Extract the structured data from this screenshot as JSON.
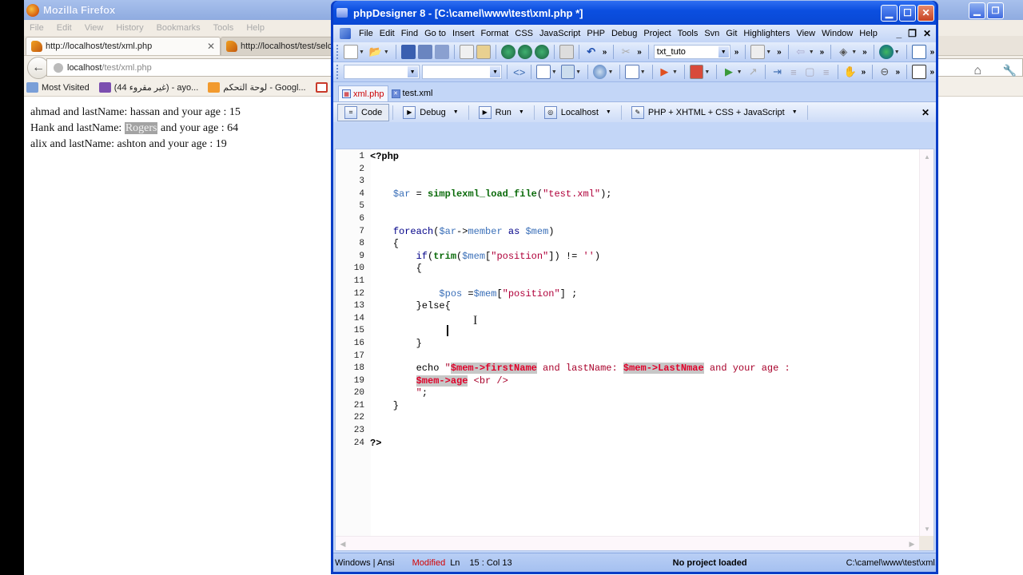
{
  "firefox": {
    "window_title": "Mozilla Firefox",
    "menu": [
      "File",
      "Edit",
      "View",
      "History",
      "Bookmarks",
      "Tools",
      "Help"
    ],
    "tabs": [
      {
        "label": "http://localhost/test/xml.php",
        "active": true
      },
      {
        "label": "http://localhost/test/selc",
        "active": false
      }
    ],
    "url": {
      "host": "localhost",
      "path": "/test/xml.php"
    },
    "bookmarks": [
      {
        "label": "Most Visited",
        "icon": "most-visited-icon"
      },
      {
        "label": "(غير مقروء 44) - ayo...",
        "icon": "mail-icon"
      },
      {
        "label": "لوحة التحكم - Googl...",
        "icon": "analytics-icon"
      },
      {
        "label": "",
        "icon": "gmail-icon"
      }
    ],
    "page_lines": [
      {
        "first": "ahmad",
        "mid": " and lastName: ",
        "last": "hassan",
        "tail": " and your age : 15",
        "selected": false
      },
      {
        "first": "Hank",
        "mid": " and lastName: ",
        "last": "Rogers",
        "tail": " and your age : 64",
        "selected": true
      },
      {
        "first": "alix",
        "mid": " and lastName: ",
        "last": "ashton",
        "tail": " and your age : 19",
        "selected": false
      }
    ]
  },
  "phpdesigner": {
    "window_title": "phpDesigner 8 - [C:\\camel\\www\\test\\xml.php *]",
    "menu": [
      "File",
      "Edit",
      "Find",
      "Go to",
      "Insert",
      "Format",
      "CSS",
      "JavaScript",
      "PHP",
      "Debug",
      "Project",
      "Tools",
      "Svn",
      "Git",
      "Highlighters",
      "View",
      "Window",
      "Help"
    ],
    "toolbar_combo_value": "txt_tuto",
    "doc_tabs": [
      {
        "label": "xml.php",
        "active": true
      },
      {
        "label": "test.xml",
        "active": false
      }
    ],
    "run_bar": {
      "code": "Code",
      "debug": "Debug",
      "run": "Run",
      "server": "Localhost",
      "highlighter": "PHP + XHTML + CSS + JavaScript"
    },
    "code_lines": [
      {
        "n": "1",
        "html": "<span class=\"php-tag\">&lt;?php</span>"
      },
      {
        "n": "2",
        "html": ""
      },
      {
        "n": "3",
        "html": ""
      },
      {
        "n": "4",
        "html": "    <span class=\"var\">$ar</span> = <span class=\"fn\">simplexml_load_file</span>(<span class=\"str\">\"test.xml\"</span>);"
      },
      {
        "n": "5",
        "html": ""
      },
      {
        "n": "6",
        "html": ""
      },
      {
        "n": "7",
        "html": "    <span class=\"kw\">foreach</span>(<span class=\"var\">$ar</span>-&gt;<span class=\"prop\">member</span> <span class=\"kw\">as</span> <span class=\"var\">$mem</span>)"
      },
      {
        "n": "8",
        "html": "    {"
      },
      {
        "n": "9",
        "html": "        <span class=\"kw\">if</span>(<span class=\"fn\">trim</span>(<span class=\"var\">$mem</span>[<span class=\"str\">\"position\"</span>]) != <span class=\"str\">''</span>)"
      },
      {
        "n": "10",
        "html": "        {"
      },
      {
        "n": "11",
        "html": ""
      },
      {
        "n": "12",
        "html": "            <span class=\"var\">$pos</span> =<span class=\"var\">$mem</span>[<span class=\"str\">\"position\"</span>] ;"
      },
      {
        "n": "13",
        "html": "        }else{"
      },
      {
        "n": "14",
        "html": ""
      },
      {
        "n": "15",
        "html": ""
      },
      {
        "n": "16",
        "html": "        }"
      },
      {
        "n": "17",
        "html": ""
      },
      {
        "n": "18",
        "html": "        echo <span class=\"echo-str\">\"<span class=\"interp\">$mem-&gt;firstName</span> and lastName: <span class=\"interp\">$mem-&gt;LastNmae</span> and your age :</span>"
      },
      {
        "n": "19",
        "html": "        <span class=\"echo-str\"><span class=\"interp\">$mem-&gt;age</span> &lt;br /&gt;</span>"
      },
      {
        "n": "20",
        "html": "        <span class=\"echo-str\">\"</span>;"
      },
      {
        "n": "21",
        "html": "    }"
      },
      {
        "n": "22",
        "html": ""
      },
      {
        "n": "23",
        "html": ""
      },
      {
        "n": "24",
        "html": "<span class=\"php-tag\">?&gt;</span>"
      }
    ],
    "status": {
      "encoding": "Windows | Ansi",
      "modified": "Modified",
      "ln_label": "Ln",
      "position": "15 : Col 13",
      "project": "No project loaded",
      "path": "C:\\camel\\www\\test\\xml.php"
    }
  }
}
